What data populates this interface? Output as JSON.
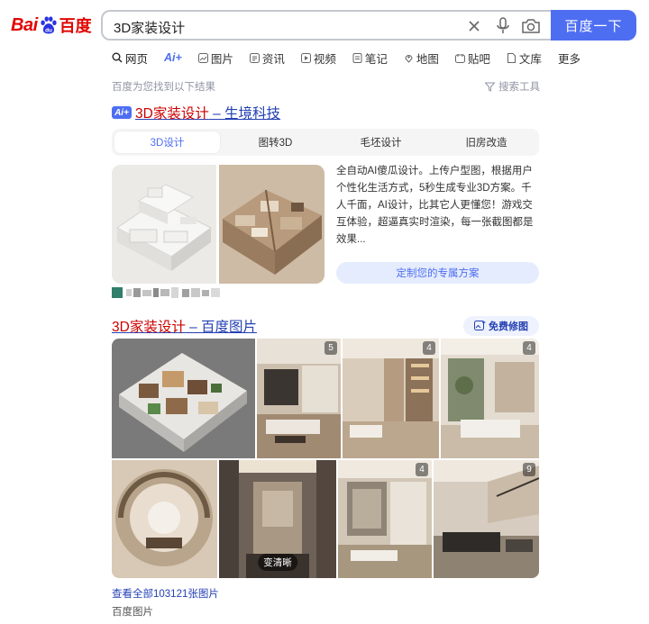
{
  "header": {
    "logo_left": "Bai",
    "logo_right": "百度",
    "search_value": "3D家装设计",
    "search_button": "百度一下"
  },
  "tabs": [
    {
      "label": "网页",
      "icon": "search-icon",
      "active": true
    },
    {
      "label": "Ai+",
      "icon": "",
      "active": false
    },
    {
      "label": "图片",
      "icon": "image-icon"
    },
    {
      "label": "资讯",
      "icon": "news-icon"
    },
    {
      "label": "视频",
      "icon": "video-icon"
    },
    {
      "label": "笔记",
      "icon": "note-icon"
    },
    {
      "label": "地图",
      "icon": "map-icon"
    },
    {
      "label": "贴吧",
      "icon": "tieba-icon"
    },
    {
      "label": "文库",
      "icon": "doc-icon"
    },
    {
      "label": "更多",
      "icon": ""
    }
  ],
  "results_meta": {
    "count_text": "百度为您找到以下结果",
    "tools_label": "搜索工具"
  },
  "result1": {
    "badge": "Ai+",
    "title_highlight": "3D家装设计",
    "title_rest": " – 生境科技",
    "subtabs": [
      "3D设计",
      "图转3D",
      "毛坯设计",
      "旧房改造"
    ],
    "description": "全自动AI傻瓜设计。上传户型图，根据用户个性化生活方式，5秒生成专业3D方案。千人千面，AI设计，比其它人更懂您！游戏交互体验，超逼真实时渲染，每一张截图都是效果...",
    "cta": "定制您的专属方案"
  },
  "result2": {
    "title_highlight": "3D家装设计",
    "title_rest": " – 百度图片",
    "badge": "免费修图",
    "image_counts": [
      "5",
      "4",
      "4",
      "4",
      "9"
    ],
    "clear_label": "变清晰",
    "see_all": "查看全部103121张图片",
    "source": "百度图片"
  },
  "colors": {
    "brand_blue": "#4e6ef2",
    "brand_red": "#e10602",
    "link_blue": "#2440b3",
    "highlight_red": "#cc0000"
  }
}
